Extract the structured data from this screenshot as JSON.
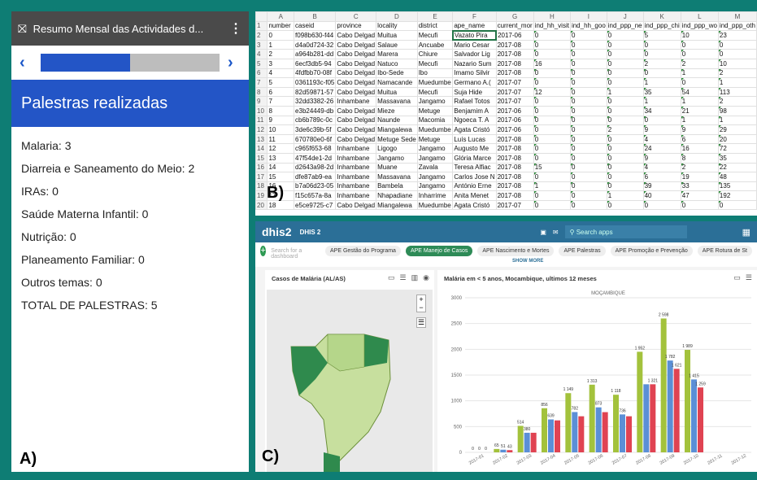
{
  "panel_a": {
    "app_title": "Resumo Mensal das Actividades d...",
    "progress_fraction": 0.5,
    "section_heading": "Palestras realizadas",
    "items": [
      {
        "label": "Malaria:",
        "value": "3"
      },
      {
        "label": "Diarreia e Saneamento do Meio:",
        "value": "2"
      },
      {
        "label": "IRAs:",
        "value": "0"
      },
      {
        "label": "Saúde Materna Infantil:",
        "value": "0"
      },
      {
        "label": "Nutrição:",
        "value": "0"
      },
      {
        "label": "Planeamento Familiar:",
        "value": "0"
      },
      {
        "label": "Outros temas:",
        "value": "0"
      },
      {
        "label": "TOTAL DE PALESTRAS:",
        "value": "5"
      }
    ],
    "tag": "A)"
  },
  "panel_b": {
    "col_letters": [
      "",
      "A",
      "B",
      "C",
      "D",
      "E",
      "F",
      "G",
      "H",
      "I",
      "J",
      "K",
      "L",
      "M"
    ],
    "headers": [
      "number",
      "caseid",
      "province",
      "locality",
      "district",
      "ape_name",
      "current_mor",
      "ind_hh_visit",
      "ind_hh_goo",
      "ind_ppp_ne",
      "ind_ppp_chi",
      "ind_ppp_wo",
      "ind_ppp_oth"
    ],
    "rows": [
      [
        "0",
        "f098b630-f44",
        "Cabo Delgad",
        "Muitua",
        "Mecufi",
        "Vazato Pira",
        "2017-06",
        "0",
        "0",
        "0",
        "5",
        "10",
        "23"
      ],
      [
        "1",
        "d4a0d724-32",
        "Cabo Delgad",
        "Salaue",
        "Ancuabe",
        "Mario Cesar",
        "2017-08",
        "0",
        "0",
        "0",
        "0",
        "0",
        "0"
      ],
      [
        "2",
        "a964b281-dd",
        "Cabo Delgad",
        "Marera",
        "Chiure",
        "Salvador Lig",
        "2017-08",
        "0",
        "0",
        "0",
        "0",
        "0",
        "0"
      ],
      [
        "3",
        "6ecf3db5-94",
        "Cabo Delgad",
        "Natuco",
        "Mecufi",
        "Nazario Sum",
        "2017-08",
        "16",
        "0",
        "0",
        "2",
        "2",
        "10"
      ],
      [
        "4",
        "4fdfbb70-08f",
        "Cabo Delgad",
        "Ibo-Sede",
        "Ibo",
        "Imamo Silvir",
        "2017-08",
        "0",
        "0",
        "0",
        "0",
        "1",
        "2"
      ],
      [
        "5",
        "0361193c-f05",
        "Cabo Delgad",
        "Namacande",
        "Muedumbe",
        "Germano A.(",
        "2017-07",
        "0",
        "0",
        "0",
        "1",
        "0",
        "1"
      ],
      [
        "6",
        "82d59871-57",
        "Cabo Delgad",
        "Muitua",
        "Mecufi",
        "Suja Hide",
        "2017-07",
        "12",
        "0",
        "1",
        "35",
        "54",
        "113"
      ],
      [
        "7",
        "32dd3382-26",
        "Inhambane",
        "Massavana",
        "Jangamo",
        "Rafael Totos",
        "2017-07",
        "0",
        "0",
        "0",
        "1",
        "1",
        "2"
      ],
      [
        "8",
        "e3b24449-db",
        "Cabo Delgad",
        "Mieze",
        "Metuge",
        "Benjamim A",
        "2017-06",
        "0",
        "0",
        "0",
        "34",
        "21",
        "98"
      ],
      [
        "9",
        "cb6b789c-0c",
        "Cabo Delgad",
        "Naunde",
        "Macomia",
        "Ngoeca T. A",
        "2017-06",
        "0",
        "0",
        "0",
        "0",
        "1",
        "1"
      ],
      [
        "10",
        "3de6c39b-5f",
        "Cabo Delgad",
        "Miangalewa",
        "Muedumbe",
        "Agata Cristó",
        "2017-06",
        "0",
        "0",
        "2",
        "9",
        "9",
        "29"
      ],
      [
        "11",
        "670780e0-6f",
        "Cabo Delgad",
        "Metuge Sede",
        "Metuge",
        "Luís Lucas",
        "2017-08",
        "0",
        "0",
        "0",
        "4",
        "6",
        "20"
      ],
      [
        "12",
        "c965f653-68",
        "Inhambane",
        "Ligogo",
        "Jangamo",
        "Augusto Me",
        "2017-08",
        "0",
        "0",
        "0",
        "24",
        "16",
        "72"
      ],
      [
        "13",
        "47f54de1-2d",
        "Inhambane",
        "Jangamo",
        "Jangamo",
        "Glória Marce",
        "2017-08",
        "0",
        "0",
        "0",
        "9",
        "8",
        "35"
      ],
      [
        "14",
        "d2643a98-2d",
        "Inhambane",
        "Muane",
        "Zavala",
        "Teresa Alfiac",
        "2017-08",
        "15",
        "0",
        "0",
        "4",
        "2",
        "22"
      ],
      [
        "15",
        "dfe87ab9-ea",
        "Inhambane",
        "Massavana",
        "Jangamo",
        "Carlos Jose N",
        "2017-08",
        "0",
        "0",
        "0",
        "6",
        "19",
        "48"
      ],
      [
        "16",
        "b7a06d23-05",
        "Inhambane",
        "Bambela",
        "Jangamo",
        "António Erne",
        "2017-08",
        "1",
        "0",
        "0",
        "39",
        "33",
        "135"
      ],
      [
        "17",
        "f15c657a-8a",
        "Inhambane",
        "Nhapadiane",
        "Inharrime",
        "Anita Menet",
        "2017-08",
        "0",
        "0",
        "1",
        "40",
        "47",
        "192"
      ],
      [
        "18",
        "e5ce9725-c7",
        "Cabo Delgad",
        "Miangalewa",
        "Muedumbe",
        "Agata Cristó",
        "2017-07",
        "0",
        "0",
        "0",
        "0",
        "0",
        "0"
      ]
    ],
    "tag": "B)"
  },
  "panel_c": {
    "logo": "dhis2",
    "instance": "DHIS 2",
    "search_placeholder": "Search apps",
    "dashboard_search": "Search for a dashboard",
    "chips": [
      "APE Gestão do Programa",
      "APE Manejo de Casos",
      "APE Nascimento e Mortes",
      "APE Palestras",
      "APE Promoção e Prevenção",
      "APE Rotura de St"
    ],
    "active_chip": 1,
    "show_more": "SHOW MORE",
    "map_title": "Casos de Malária (AL/AS)",
    "chart_title": "Malária em < 5 anos, Mocambique, ultimos 12 meses",
    "tag": "C)"
  },
  "chart_data": {
    "type": "bar",
    "subtitle": "MOÇAMBIQUE",
    "categories": [
      "2017-01",
      "2017-02",
      "2017-03",
      "2017-04",
      "2017-05",
      "2017-06",
      "2017-07",
      "2017-08",
      "2017-09",
      "2017-10",
      "2017-11",
      "2017-12"
    ],
    "series": [
      {
        "values": [
          0,
          65,
          514,
          856,
          1149,
          1313,
          1118,
          1952,
          2598,
          1989
        ],
        "color": "#a3c23c"
      },
      {
        "values": [
          0,
          51,
          380,
          639,
          782,
          873,
          736,
          1321,
          1782,
          1415
        ],
        "color": "#5b8fd6"
      },
      {
        "values": [
          0,
          43,
          380,
          620,
          700,
          780,
          700,
          1321,
          1621,
          1259
        ],
        "color": "#e04352"
      }
    ],
    "ylim": [
      0,
      3000
    ],
    "yticks": [
      0,
      500,
      1000,
      1500,
      2000,
      2500,
      3000
    ],
    "bar_labels": [
      "0",
      "0",
      "0",
      "65",
      "51",
      "43",
      "514",
      "380",
      "",
      "856",
      "639",
      "",
      "1 149",
      "782",
      "",
      "1 313",
      "873",
      "",
      "1 118",
      "736",
      "",
      "1 952",
      "",
      "1 321",
      "2 598",
      "1 782",
      "1 621",
      "1 989",
      "1 415",
      "1 259"
    ]
  }
}
